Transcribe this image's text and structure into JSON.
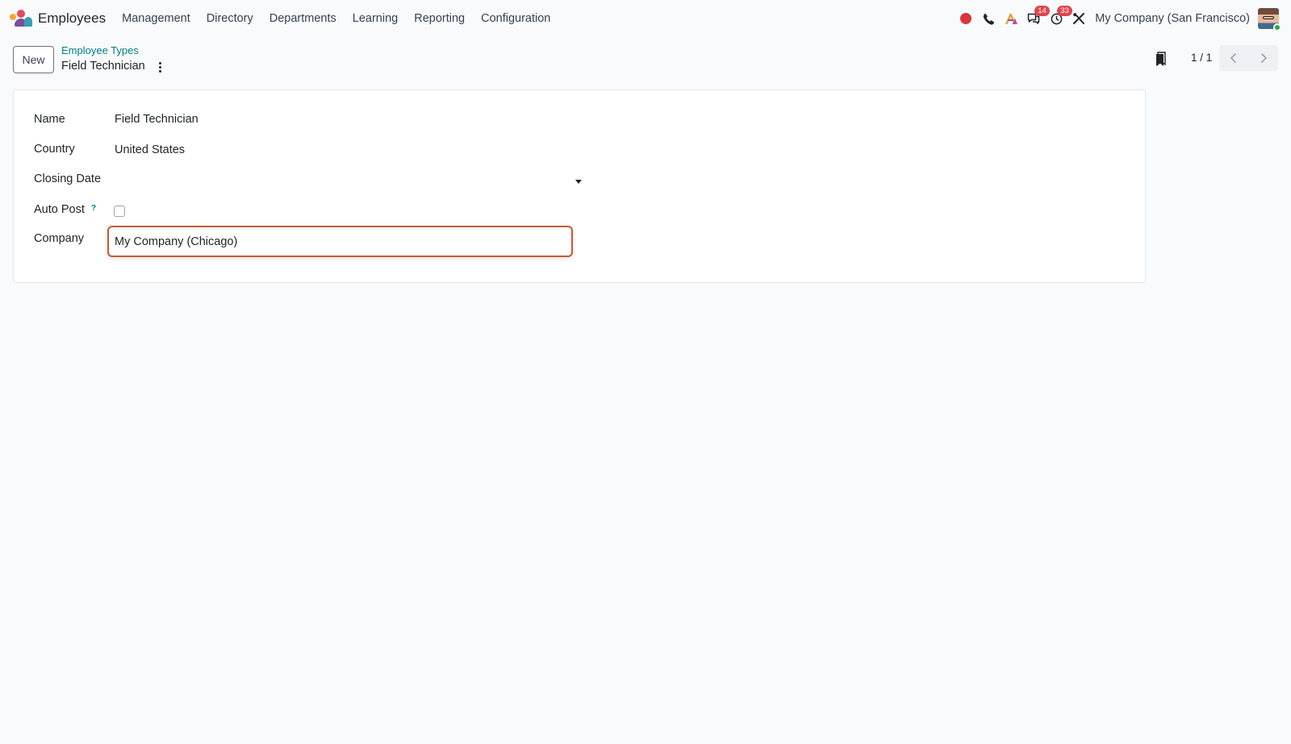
{
  "navbar": {
    "app_name": "Employees",
    "menu": [
      "Management",
      "Directory",
      "Departments",
      "Learning",
      "Reporting",
      "Configuration"
    ],
    "systray": {
      "messages_count": "14",
      "activities_count": "33",
      "company": "My Company (San Francisco)"
    }
  },
  "control_panel": {
    "new_button": "New",
    "breadcrumb": "Employee Types",
    "record_title": "Field Technician",
    "pager": "1 / 1"
  },
  "form": {
    "name_label": "Name",
    "name_value": "Field Technician",
    "country_label": "Country",
    "country_value": "United States",
    "closing_date_label": "Closing Date",
    "closing_date_value": "",
    "auto_post_label": "Auto Post",
    "auto_post_help": "?",
    "auto_post_checked": false,
    "company_label": "Company",
    "company_value": "My Company (Chicago)"
  },
  "colors": {
    "accent": "#017e84",
    "focus_border": "#c65a33",
    "badge": "#e0454e",
    "record_dot": "#d9363e"
  }
}
